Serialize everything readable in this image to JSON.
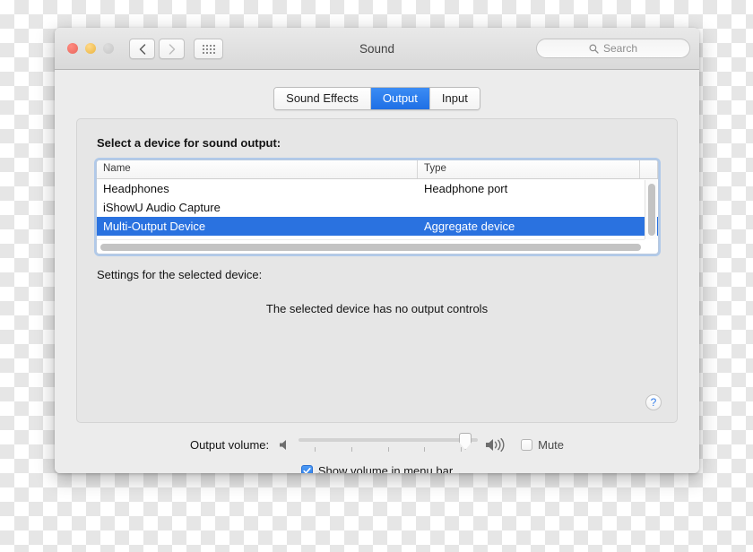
{
  "window": {
    "title": "Sound",
    "traffic_lights": [
      "close",
      "minimize",
      "zoom"
    ],
    "nav": {
      "back": "back-arrow",
      "forward": "forward-arrow",
      "showall": "show-all-grid"
    },
    "search": {
      "placeholder": "Search",
      "icon": "search-icon"
    }
  },
  "tabs": [
    {
      "label": "Sound Effects",
      "selected": false
    },
    {
      "label": "Output",
      "selected": true
    },
    {
      "label": "Input",
      "selected": false
    }
  ],
  "panel": {
    "select_label": "Select a device for sound output:",
    "settings_label": "Settings for the selected device:",
    "no_controls_message": "The selected device has no output controls",
    "help_glyph": "?"
  },
  "device_table": {
    "columns": [
      "Name",
      "Type"
    ],
    "rows": [
      {
        "name": "Headphones",
        "type": "Headphone port",
        "selected": false
      },
      {
        "name": "iShowU Audio Capture",
        "type": "",
        "selected": false
      },
      {
        "name": "Multi-Output Device",
        "type": "Aggregate device",
        "selected": true
      }
    ]
  },
  "volume": {
    "label": "Output volume:",
    "low_icon": "speaker-low-icon",
    "high_icon": "speaker-high-icon",
    "value_percent": 93,
    "tick_count": 5,
    "mute": {
      "label": "Mute",
      "checked": false
    }
  },
  "menubar_option": {
    "label": "Show volume in menu bar",
    "checked": true,
    "check_glyph": "✓"
  },
  "colors": {
    "accent_blue": "#2a72e0",
    "tab_blue": "#2f7fe8",
    "window_bg": "#ececec",
    "panel_bg": "#e6e6e6",
    "help_blue": "#2f7bea"
  }
}
